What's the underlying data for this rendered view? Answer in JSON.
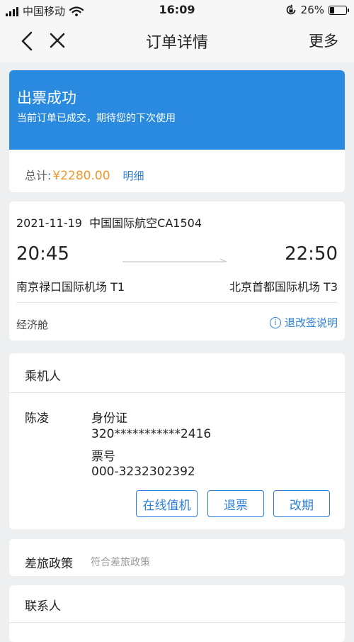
{
  "status_bar": {
    "carrier": "中国移动",
    "time": "16:09",
    "battery_percent": "26%",
    "battery_level": 0.26,
    "icons": [
      "signal-icon",
      "wifi-icon",
      "rotation-lock-icon",
      "battery-icon"
    ]
  },
  "nav": {
    "title": "订单详情",
    "more": "更多",
    "back_icon": "chevron-left-icon",
    "close_icon": "close-icon"
  },
  "order": {
    "status_title": "出票成功",
    "status_subtitle": "当前订单已成交，期待您的下次使用",
    "total_label": "总计:",
    "total_amount": "¥2280.00",
    "detail_link": "明细",
    "colors": {
      "banner": "#2a8ae0",
      "price": "#f0972b",
      "link": "#2b7fd6"
    }
  },
  "flight": {
    "date_airline": "2021-11-19  中国国际航空CA1504",
    "departure_time": "20:45",
    "arrival_time": "22:50",
    "departure_airport": "南京禄口国际机场 T1",
    "arrival_airport": "北京首都国际机场 T3",
    "cabin": "经济舱",
    "rules_link": "退改签说明",
    "rules_icon": "info-icon"
  },
  "passenger": {
    "section_title": "乘机人",
    "name": "陈凌",
    "id_type": "身份证",
    "id_number": "320***********2416",
    "ticket_label": "票号",
    "ticket_number": "000-3232302392",
    "buttons": {
      "checkin": "在线值机",
      "refund": "退票",
      "change": "改期"
    }
  },
  "travel_policy": {
    "label": "差旅政策",
    "value": "符合差旅政策"
  },
  "contact": {
    "label": "联系人"
  }
}
